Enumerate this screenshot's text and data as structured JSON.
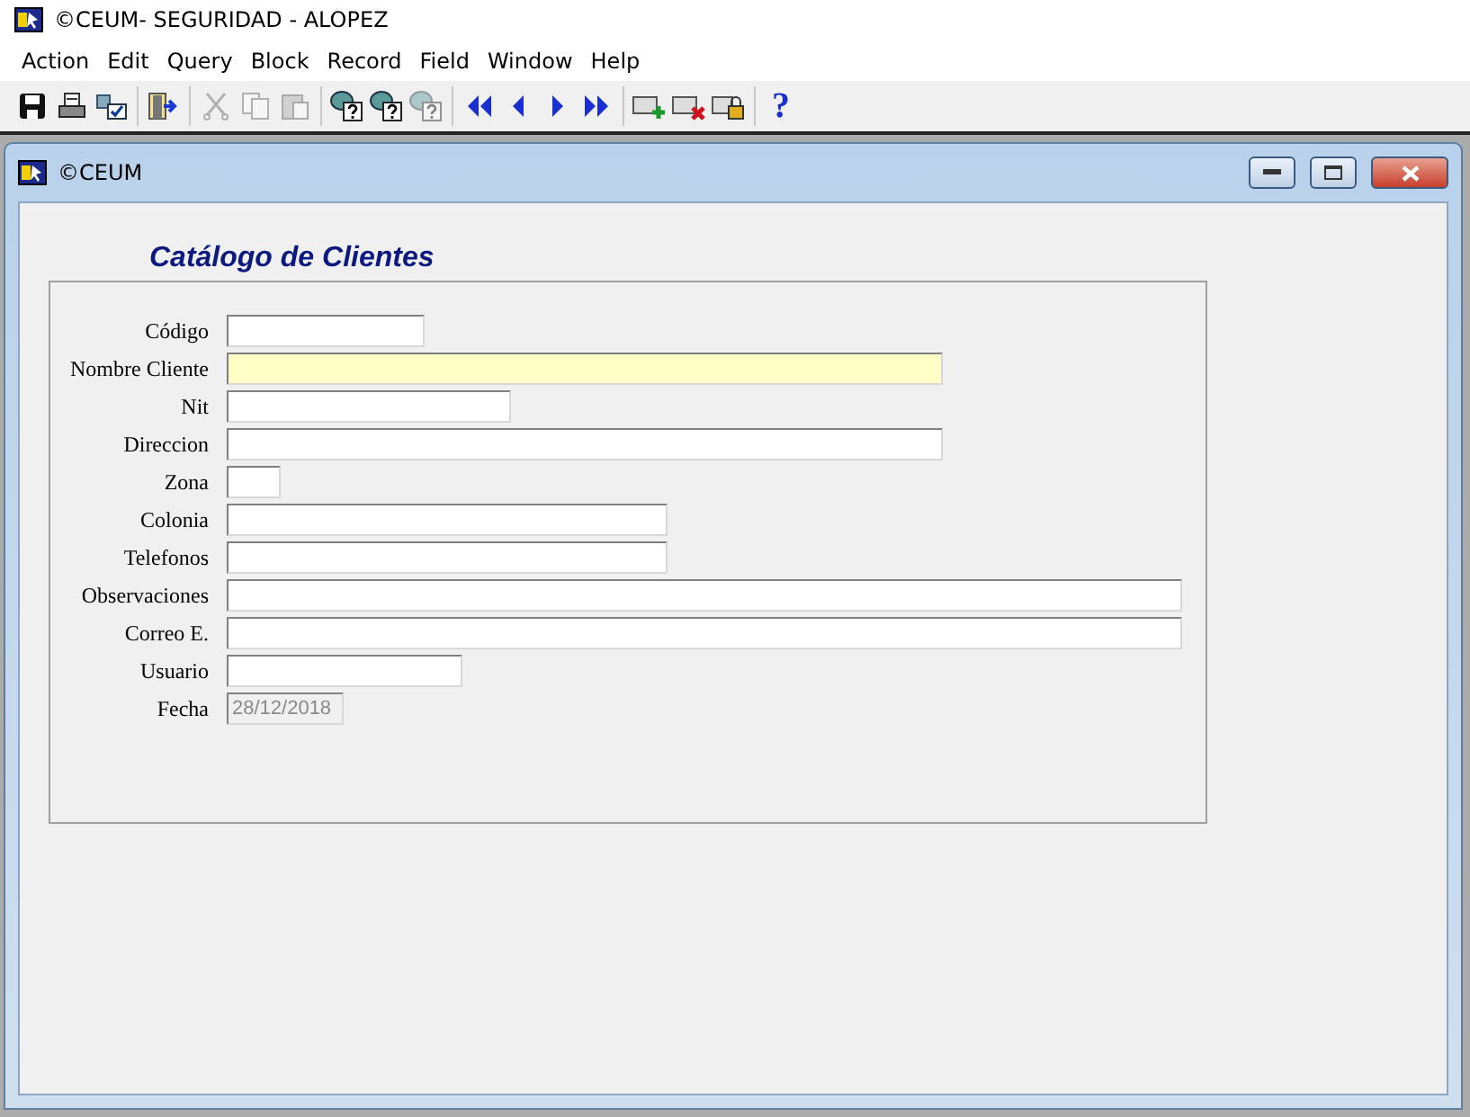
{
  "window": {
    "title": "©CEUM- SEGURIDAD - ALOPEZ"
  },
  "menu": [
    "Action",
    "Edit",
    "Query",
    "Block",
    "Record",
    "Field",
    "Window",
    "Help"
  ],
  "toolbar": [
    [
      {
        "kind": "save",
        "disabled": false
      },
      {
        "kind": "print",
        "disabled": false
      },
      {
        "kind": "check",
        "disabled": false
      }
    ],
    [
      {
        "kind": "exit",
        "disabled": false
      }
    ],
    [
      {
        "kind": "cut",
        "disabled": true
      },
      {
        "kind": "copy",
        "disabled": true
      },
      {
        "kind": "paste",
        "disabled": true
      }
    ],
    [
      {
        "kind": "query",
        "disabled": false
      },
      {
        "kind": "query",
        "disabled": false
      },
      {
        "kind": "query",
        "disabled": true
      }
    ],
    [
      {
        "kind": "first",
        "disabled": false
      },
      {
        "kind": "prev",
        "disabled": false
      },
      {
        "kind": "next",
        "disabled": false
      },
      {
        "kind": "last",
        "disabled": false
      }
    ],
    [
      {
        "kind": "insert",
        "disabled": false
      },
      {
        "kind": "delete",
        "disabled": false
      },
      {
        "kind": "lock",
        "disabled": false
      }
    ],
    [
      {
        "kind": "help",
        "label": "?",
        "disabled": false
      }
    ]
  ],
  "child_window": {
    "title": "©CEUM"
  },
  "form": {
    "title": "Catálogo de Clientes",
    "fields": [
      {
        "label": "Código",
        "focused": false,
        "disabled": false
      },
      {
        "label": "Nombre Cliente",
        "focused": true,
        "disabled": false
      },
      {
        "label": "Nit",
        "focused": false,
        "disabled": false
      },
      {
        "label": "Direccion",
        "focused": false,
        "disabled": false
      },
      {
        "label": "Zona",
        "focused": false,
        "disabled": false
      },
      {
        "label": "Colonia",
        "focused": false,
        "disabled": false
      },
      {
        "label": "Telefonos",
        "focused": false,
        "disabled": false
      },
      {
        "label": "Observaciones",
        "focused": false,
        "disabled": false
      },
      {
        "label": "Correo E.",
        "focused": false,
        "disabled": false
      },
      {
        "label": "Usuario",
        "focused": false,
        "disabled": false
      },
      {
        "label": "Fecha",
        "value": "28/12/2018",
        "focused": false,
        "disabled": true
      }
    ]
  }
}
